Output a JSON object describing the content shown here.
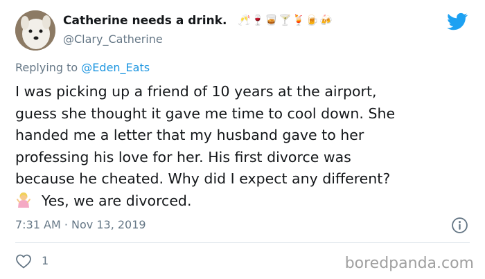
{
  "tweet": {
    "display_name": "Catherine needs a drink.",
    "name_emojis": "🥂🍷🥃🍸🍹🍺🍻",
    "handle": "@Clary_Catherine",
    "replying_prefix": "Replying to",
    "replying_to": "@Eden_Eats",
    "text_lines": [
      "I was picking up a friend of 10 years at the airport,",
      "guess she thought it gave me time to cool down. She",
      "handed me a letter that my husband gave to her",
      "professing his love for her. His first divorce was",
      "because he cheated. Why did I expect any different?",
      "Yes, we are divorced."
    ],
    "timestamp": "7:31 AM · Nov 13, 2019",
    "like_count": "1"
  },
  "watermark": "boredpanda.com",
  "icons": {
    "avatar": "avatar",
    "brand": "twitter-bird-icon",
    "emoji": "person-shrugging-emoji",
    "info": "info-icon",
    "like": "heart-icon"
  },
  "colors": {
    "twitter_blue": "#1da1f2",
    "mention_blue": "#1b95e0",
    "muted_gray": "#657786"
  }
}
